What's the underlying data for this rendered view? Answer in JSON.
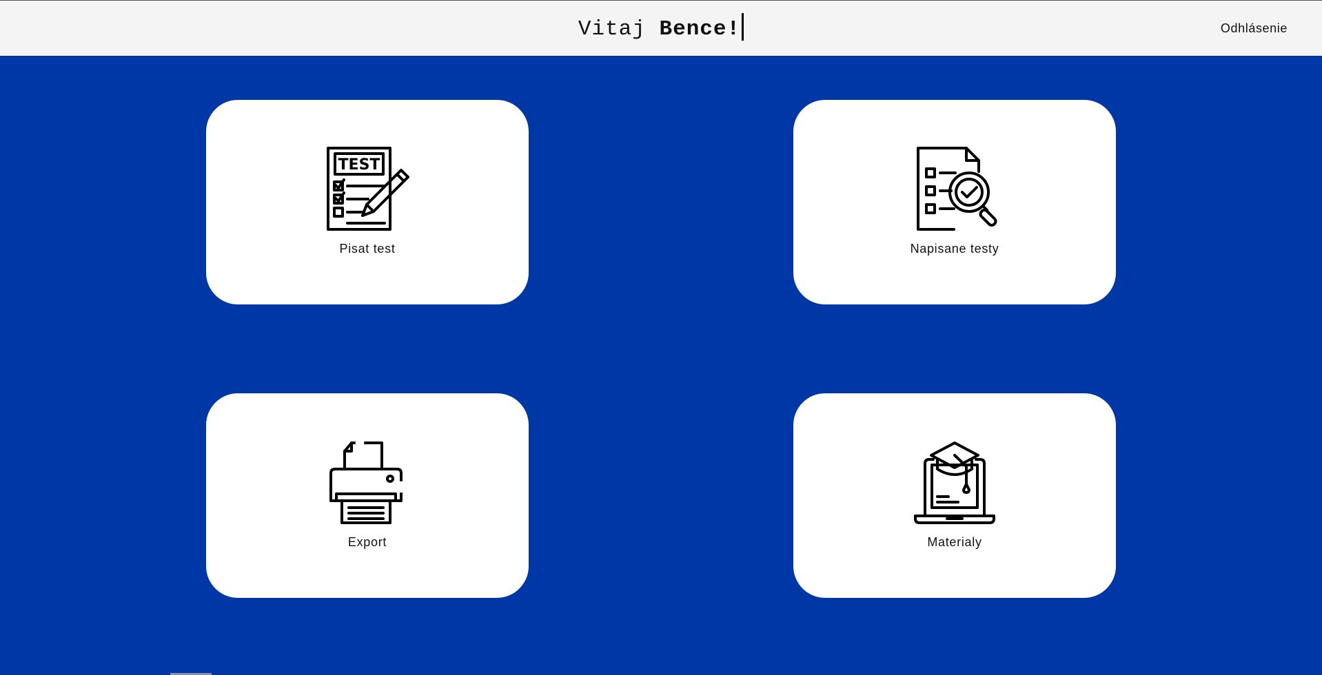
{
  "header": {
    "greeting_prefix": "Vitaj ",
    "user_name": "Bence!",
    "logout_label": "Odhlásenie"
  },
  "cards": [
    {
      "label": "Pisat test",
      "icon": "test-sheet-pencil-icon"
    },
    {
      "label": "Napisane testy",
      "icon": "document-magnifier-check-icon"
    },
    {
      "label": "Export",
      "icon": "printer-icon"
    },
    {
      "label": "Materialy",
      "icon": "laptop-graduation-cap-icon"
    }
  ],
  "colors": {
    "background": "#0037a6",
    "header": "#f4f4f4",
    "card": "#ffffff"
  }
}
